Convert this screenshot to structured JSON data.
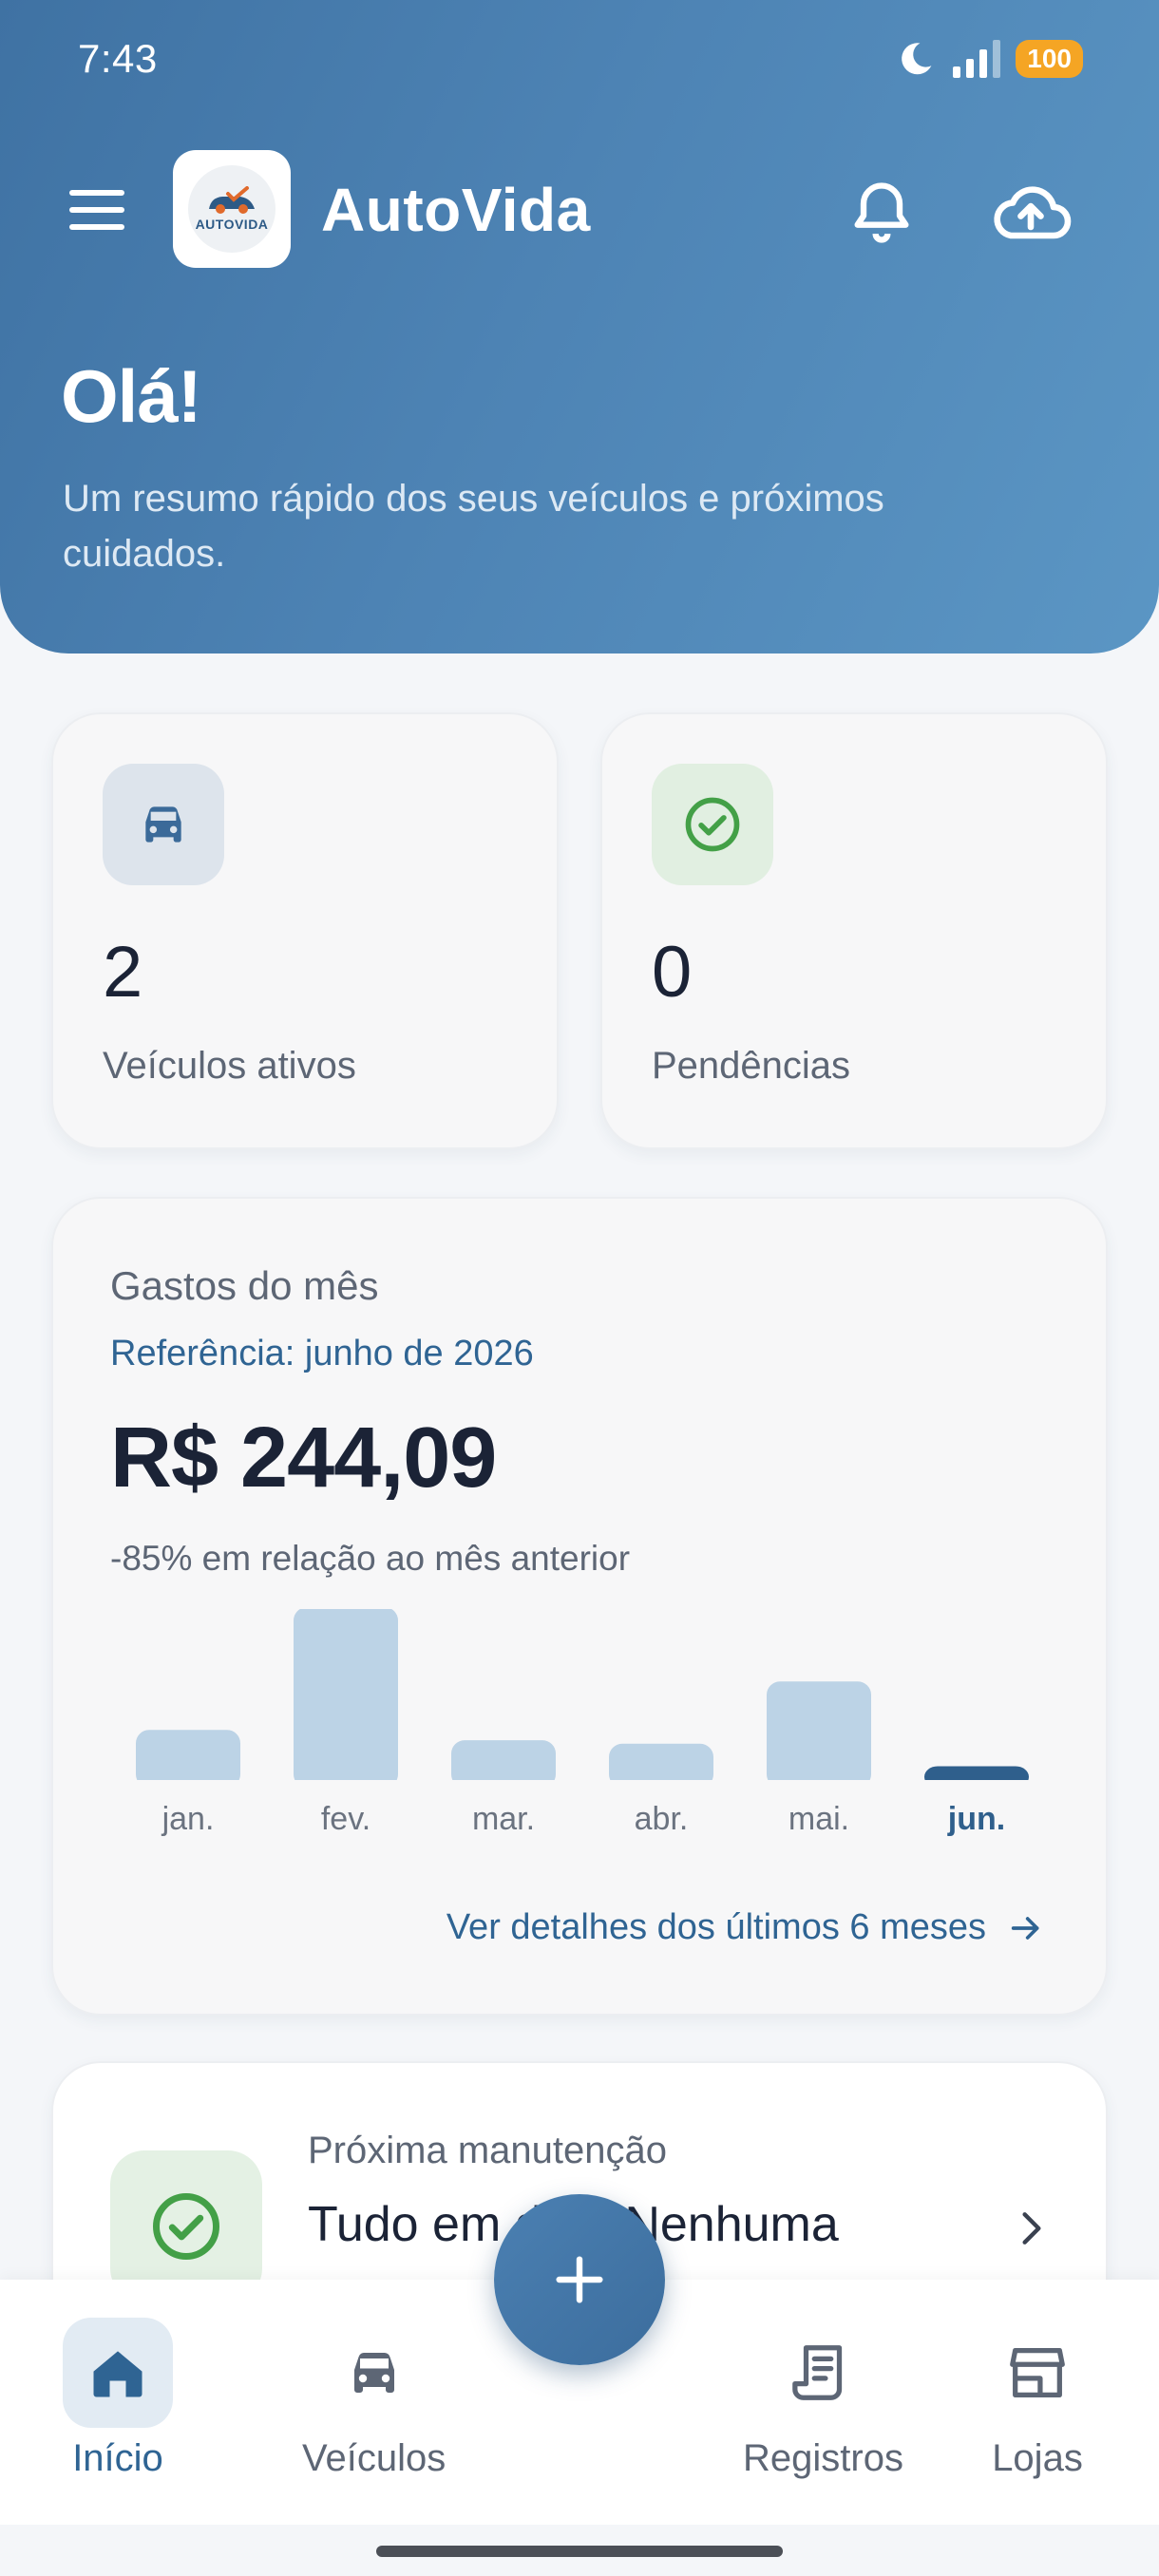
{
  "status_bar": {
    "time": "7:43",
    "battery": "100"
  },
  "app": {
    "name": "AutoVida",
    "logo_text": "AUTOVIDA"
  },
  "header": {
    "greeting": "Olá!",
    "subtitle": "Um resumo rápido dos seus veículos e próximos cuidados."
  },
  "stats": [
    {
      "value": "2",
      "label": "Veículos ativos",
      "icon": "car-icon"
    },
    {
      "value": "0",
      "label": "Pendências",
      "icon": "check-circle-icon"
    }
  ],
  "expenses": {
    "title": "Gastos do mês",
    "reference": "Referência: junho de 2026",
    "amount": "R$ 244,09",
    "change": "-85% em relação ao mês anterior",
    "link": "Ver detalhes dos últimos 6 meses"
  },
  "chart_data": {
    "type": "bar",
    "categories": [
      "jan.",
      "fev.",
      "mar.",
      "abr.",
      "mai.",
      "jun."
    ],
    "values": [
      0.29,
      1.0,
      0.23,
      0.21,
      0.57,
      0.08
    ],
    "highlight": "jun.",
    "colors": {
      "bar": "#bcd3e6",
      "highlight": "#2f5f8c"
    }
  },
  "next_maintenance": {
    "label": "Próxima manutenção",
    "title": "Tudo em dia · Nenhuma"
  },
  "nav": {
    "items": [
      {
        "label": "Início"
      },
      {
        "label": "Veículos"
      },
      {
        "label": "Registros"
      },
      {
        "label": "Lojas"
      }
    ]
  },
  "colors": {
    "header": "#4a7fb0",
    "accent": "#2f6493",
    "success": "#43a047"
  }
}
